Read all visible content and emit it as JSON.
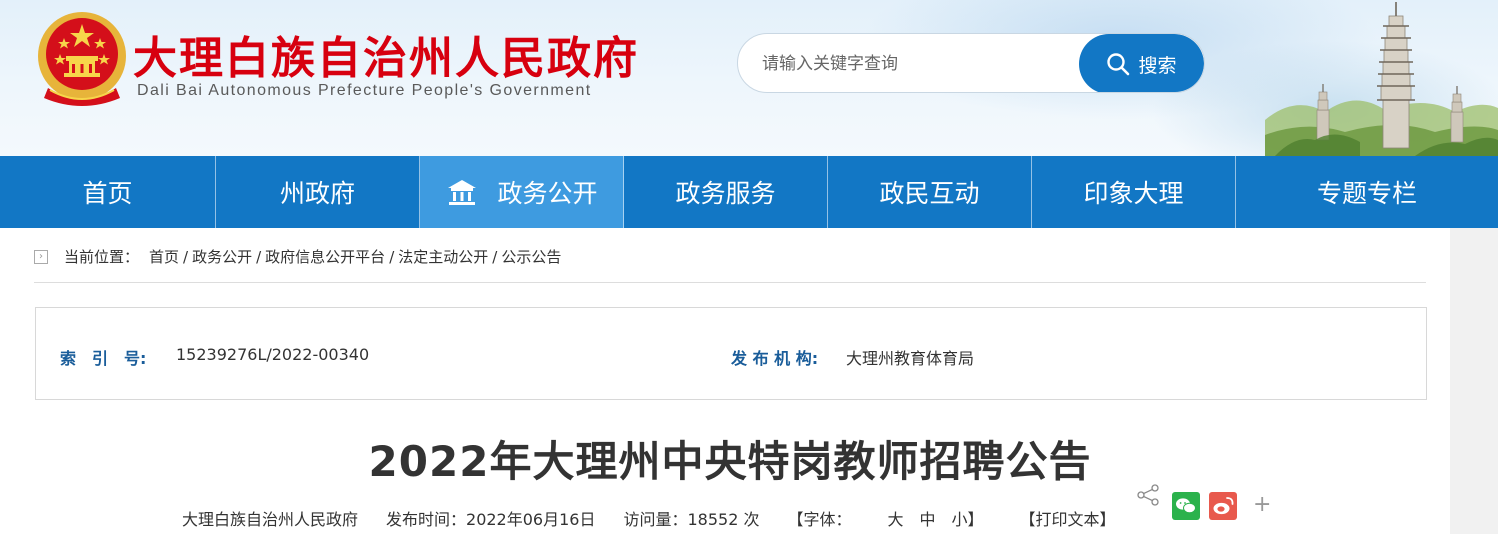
{
  "header": {
    "title": "大理白族自治州人民政府",
    "subtitle": "Dali Bai Autonomous Prefecture People's Government",
    "search": {
      "placeholder": "请输入关键字查询",
      "button_label": "搜索"
    }
  },
  "nav": {
    "items": [
      {
        "label": "首页"
      },
      {
        "label": "州政府"
      },
      {
        "label": "政务公开"
      },
      {
        "label": "政务服务"
      },
      {
        "label": "政民互动"
      },
      {
        "label": "印象大理"
      },
      {
        "label": "专题专栏"
      }
    ],
    "active_index": 2
  },
  "breadcrumb": {
    "prefix": "当前位置：",
    "items": [
      "首页",
      "政务公开",
      "政府信息公开平台",
      "法定主动公开",
      "公示公告"
    ],
    "separator": "/"
  },
  "meta": {
    "index_label": "索　引　号:",
    "index_value": "15239276L/2022-00340",
    "publisher_label": "发 布 机 构:",
    "publisher_value": "大理州教育体育局"
  },
  "article": {
    "title": "2022年大理州中央特岗教师招聘公告",
    "source": "大理白族自治州人民政府",
    "publish_time": "发布时间：2022年06月16日",
    "visits": "访问量：18552 次",
    "font_label": "【字体：",
    "font_large": "大",
    "font_medium": "中",
    "font_small": "小】",
    "print": "【打印文本】"
  },
  "colors": {
    "title_red": "#d7000f",
    "nav_blue": "#1277c5",
    "nav_active": "#3e9be0",
    "meta_label_blue": "#1a5d9a"
  }
}
